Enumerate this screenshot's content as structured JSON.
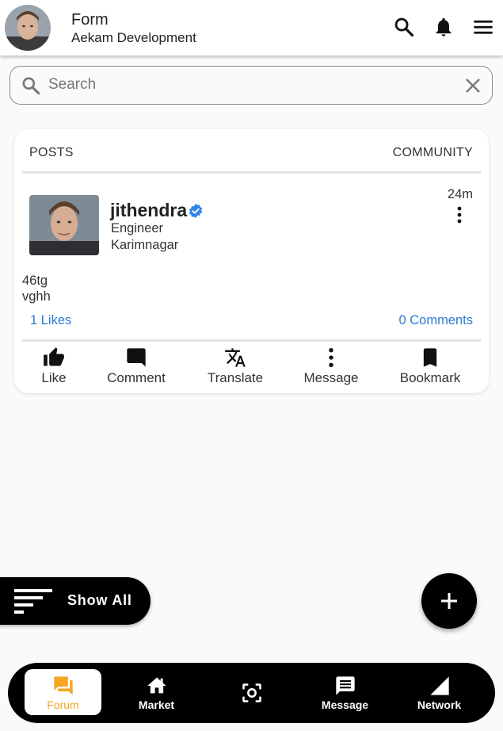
{
  "header": {
    "title": "Form",
    "subtitle": "Aekam Development",
    "icons": [
      "search-icon",
      "notifications-icon",
      "menu-icon"
    ]
  },
  "search": {
    "placeholder": "Search",
    "value": ""
  },
  "tabs": [
    {
      "label": "POSTS"
    },
    {
      "label": "COMMUNITY"
    }
  ],
  "post": {
    "author": "jithendra",
    "verified": true,
    "role": "Engineer",
    "location": "Karimnagar",
    "time": "24m",
    "body_lines": [
      "46tg",
      "vghh"
    ],
    "likes": "1 Likes",
    "comments": "0 Comments",
    "actions": [
      {
        "label": "Like",
        "icon": "thumb-up-icon"
      },
      {
        "label": "Comment",
        "icon": "comment-icon"
      },
      {
        "label": "Translate",
        "icon": "translate-icon"
      },
      {
        "label": "Message",
        "icon": "more-vert-icon"
      },
      {
        "label": "Bookmark",
        "icon": "bookmark-icon"
      }
    ]
  },
  "show_all": {
    "label": "Show All"
  },
  "bottom_nav": [
    {
      "label": "Forum",
      "icon": "forum-icon",
      "active": true
    },
    {
      "label": "Market",
      "icon": "home-icon",
      "active": false
    },
    {
      "label": "",
      "icon": "scan-icon",
      "active": false
    },
    {
      "label": "Message",
      "icon": "message-icon",
      "active": false
    },
    {
      "label": "Network",
      "icon": "signal-icon",
      "active": false
    }
  ],
  "colors": {
    "accent_blue": "#2a7bd6",
    "active_orange": "#f5a623",
    "verified_blue": "#2f86e8"
  }
}
